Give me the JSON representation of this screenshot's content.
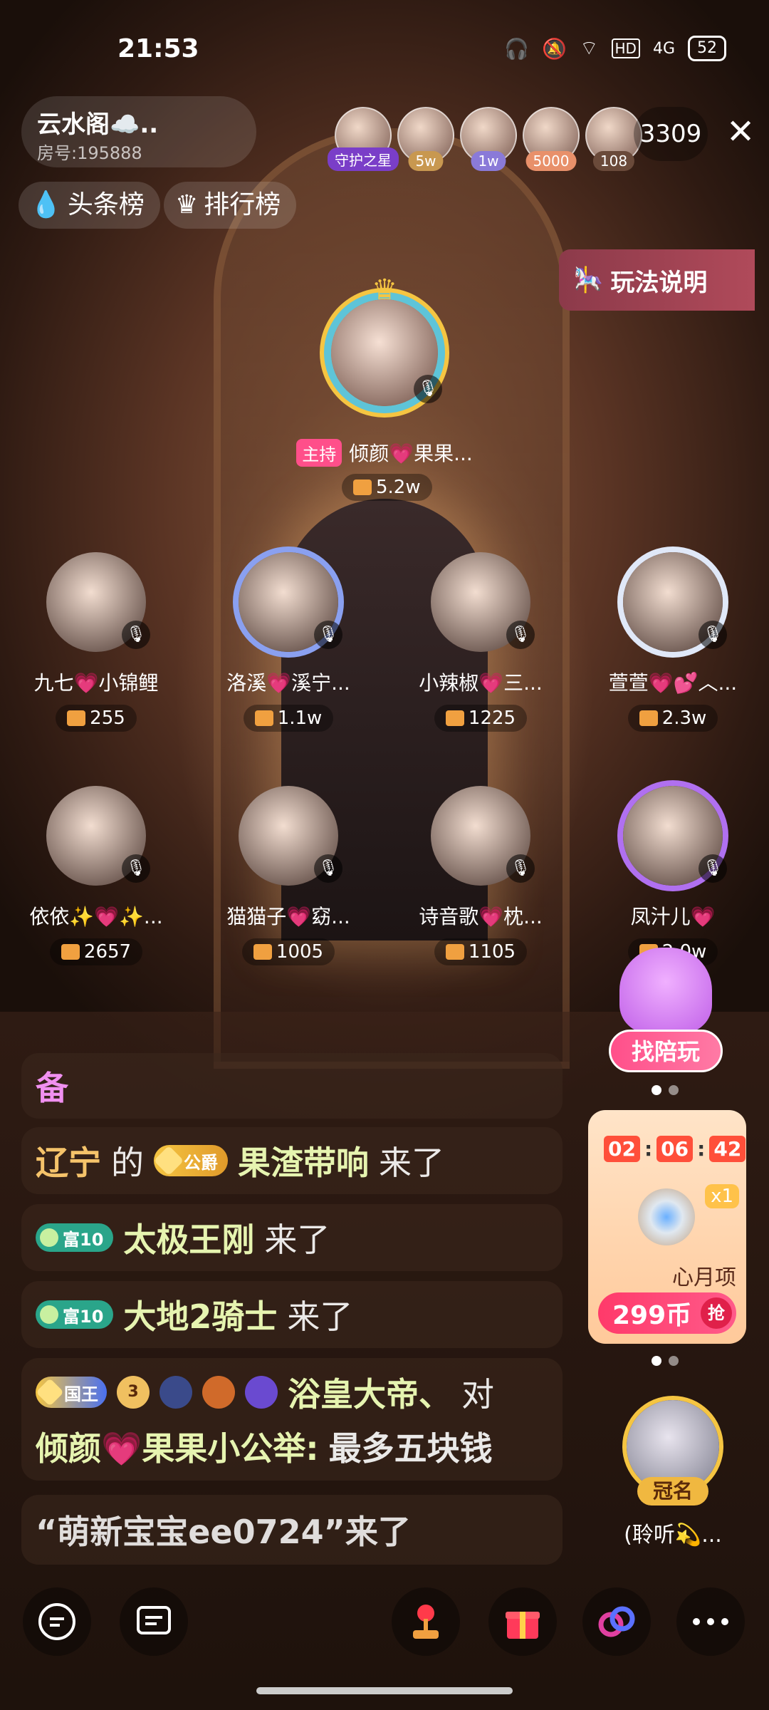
{
  "status": {
    "time": "21:53",
    "battery": "52",
    "hd": "HD",
    "net": "4G"
  },
  "room": {
    "name": "云水阁☁️..",
    "id": "房号:195888"
  },
  "top_avatars": [
    {
      "badge": "守护之星",
      "color": "#7a3ec8"
    },
    {
      "badge": "5w",
      "color": "#c89850"
    },
    {
      "badge": "1w",
      "color": "#8a7ad8"
    },
    {
      "badge": "5000",
      "color": "#e8906a"
    },
    {
      "badge": "108",
      "color": "#6a4a3a"
    }
  ],
  "viewer_count": "3309",
  "tabs": {
    "headline": "头条榜",
    "ranking": "排行榜"
  },
  "rules_label": "玩法说明",
  "host": {
    "tag": "主持",
    "name": "倾颜💗果果...",
    "score": "5.2w"
  },
  "seats": [
    {
      "name": "九七💗小锦鲤",
      "score": "255"
    },
    {
      "name": "洛溪💗溪宁...",
      "score": "1.1w"
    },
    {
      "name": "小辣椒💗三...",
      "score": "1225"
    },
    {
      "name": "萱萱💗💕︿...",
      "score": "2.3w"
    },
    {
      "name": "依依✨💗✨...",
      "score": "2657"
    },
    {
      "name": "猫猫子💗窈...",
      "score": "1005"
    },
    {
      "name": "诗音歌💗枕...",
      "score": "1105"
    },
    {
      "name": "凤汁儿💗",
      "score": "2.0w"
    }
  ],
  "side": {
    "find_label": "找陪玩",
    "timer": [
      "02",
      "06",
      "42"
    ],
    "multiplier": "x1",
    "item_label": "心月项",
    "price": "299币",
    "grab": "抢",
    "crown_tag": "冠名",
    "crown_user": "(聆听💫..."
  },
  "chat": {
    "standby": "备",
    "msg1": {
      "prefix": "辽宁",
      "de": "的",
      "badge": "公爵",
      "user": "果渣带响",
      "action": "来了"
    },
    "msg2": {
      "badge": "富10",
      "user": "太极王刚",
      "action": "来了"
    },
    "msg3": {
      "badge": "富10",
      "user": "大地2骑士",
      "action": "来了"
    },
    "msg4": {
      "badge": "国王",
      "level": "3",
      "user": "浴皇大帝、",
      "to": "对",
      "target": "倾颜💗果果小公举:",
      "text": "最多五块钱"
    },
    "msg5": "“萌新宝宝ee0724”来了"
  },
  "bottom": [
    "chat-bubble-icon",
    "message-icon",
    "game-icon",
    "gift-icon",
    "link-icon",
    "more-icon"
  ]
}
